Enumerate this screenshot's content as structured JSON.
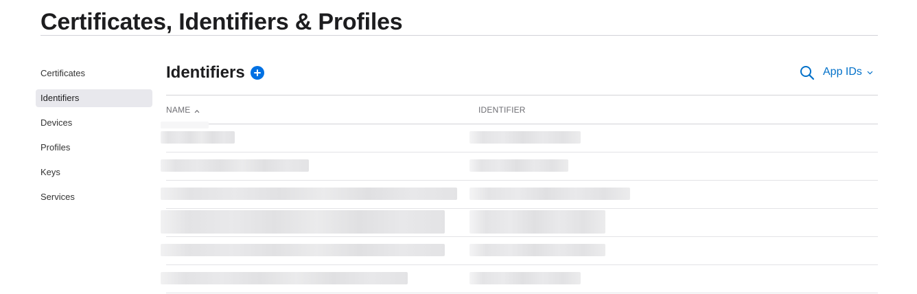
{
  "page": {
    "title": "Certificates, Identifiers & Profiles"
  },
  "sidebar": {
    "items": [
      {
        "label": "Certificates"
      },
      {
        "label": "Identifiers",
        "active": true
      },
      {
        "label": "Devices"
      },
      {
        "label": "Profiles"
      },
      {
        "label": "Keys"
      },
      {
        "label": "Services"
      }
    ]
  },
  "main": {
    "title": "Identifiers",
    "filter_label": "App IDs",
    "columns": {
      "name": "NAME",
      "identifier": "IDENTIFIER"
    },
    "sort": {
      "column": "name",
      "direction": "ascending"
    },
    "rows_note": "row contents are pixelated/redacted in the screenshot"
  },
  "colors": {
    "accent": "#0071e3",
    "link": "#0070c9",
    "active_bg": "#e8e8ed"
  },
  "icons": [
    "plus-circle-icon",
    "search-icon",
    "chevron-down-icon",
    "sort-ascending-icon"
  ]
}
